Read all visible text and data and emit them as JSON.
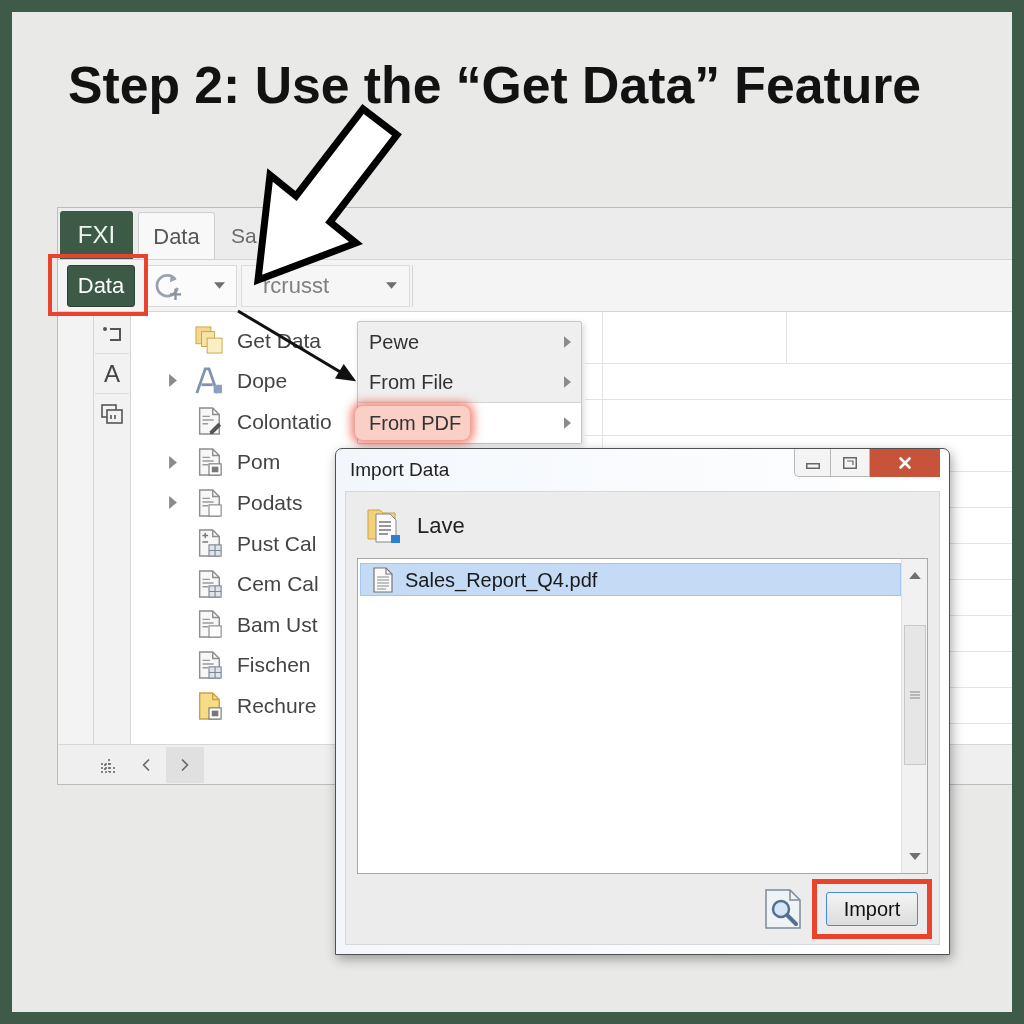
{
  "title": "Step 2: Use the “Get Data” Feature",
  "app": {
    "tabs": [
      {
        "label": "FXI",
        "kind": "file",
        "selected": false
      },
      {
        "label": "Data",
        "kind": "tab",
        "selected": true
      },
      {
        "label": "Sa",
        "kind": "tab",
        "selected": false
      }
    ],
    "toolbar": {
      "data_button": {
        "label": "Data",
        "highlighted": true
      },
      "dropdowns": [
        {
          "kind": "icon"
        },
        {
          "kind": "text",
          "value": "rcrusst"
        }
      ]
    },
    "side_rail": {
      "letter": "A"
    },
    "tree": [
      {
        "label": "Get Data",
        "expandable": false
      },
      {
        "label": "Dope",
        "expandable": true
      },
      {
        "label": "Colontatio",
        "expandable": false
      },
      {
        "label": "Pom",
        "expandable": true
      },
      {
        "label": "Podats",
        "expandable": true
      },
      {
        "label": "Pust Cal",
        "expandable": false
      },
      {
        "label": "Cem Cal",
        "expandable": false
      },
      {
        "label": "Bam Ust",
        "expandable": false
      },
      {
        "label": "Fischen",
        "expandable": false
      },
      {
        "label": "Rechure",
        "expandable": false
      }
    ],
    "menu": [
      {
        "label": "Pewe",
        "submenu": true,
        "separator_above": false,
        "highlighted": false
      },
      {
        "label": "From File",
        "submenu": true,
        "separator_above": false,
        "highlighted": false
      },
      {
        "label": "From PDF",
        "submenu": true,
        "separator_above": true,
        "highlighted": true
      }
    ]
  },
  "dialog": {
    "title": "Import Data",
    "location": "Lave",
    "files": [
      {
        "name": "Sales_Report_Q4.pdf",
        "selected": true
      }
    ],
    "import_button": {
      "label": "Import",
      "highlighted": true
    }
  }
}
